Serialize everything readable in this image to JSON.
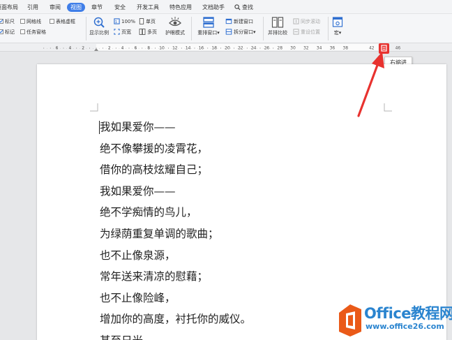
{
  "menu": {
    "tabs": [
      "页面布局",
      "引用",
      "审阅",
      "视图",
      "章节",
      "安全",
      "开发工具",
      "特色应用",
      "文档助手"
    ],
    "active_tab": "视图",
    "search_label": "查找"
  },
  "ribbon": {
    "checkboxes": {
      "ruler": "标尺",
      "gridlines": "网格线",
      "table_gridlines": "表格虚框",
      "marks": "标记",
      "task_pane": "任务窗格"
    },
    "display_ratio": "显示比例",
    "zoom_100": "100%",
    "page_width": "页宽",
    "single_page": "单页",
    "multi_page": "多页",
    "eye_mode": "护眼模式",
    "rearrange_window": "重排窗口",
    "new_window": "新建窗口",
    "split_window": "拆分窗口",
    "side_by_side": "并排比较",
    "sync_scroll": "同步滚动",
    "reset_position": "重设位置",
    "macro": "宏"
  },
  "ruler": {
    "labels": [
      "6",
      "4",
      "2",
      "2",
      "4",
      "6",
      "8",
      "10",
      "12",
      "14",
      "16",
      "18",
      "20",
      "22",
      "24",
      "26",
      "28",
      "30",
      "32",
      "34",
      "36",
      "38",
      "42",
      "44",
      "46"
    ]
  },
  "tooltip": {
    "text": "右缩进"
  },
  "document": {
    "lines": [
      "我如果爱你——",
      "绝不像攀援的凌霄花，",
      "借你的高枝炫耀自己；",
      "我如果爱你——",
      "绝不学痴情的鸟儿，",
      "为绿荫重复单调的歌曲；",
      "也不止像泉源，",
      "常年送来清凉的慰藉；",
      "也不止像险峰，",
      "增加你的高度，衬托你的威仪。",
      "甚至日光"
    ]
  },
  "watermark": {
    "title": "Office教程网",
    "url": "www.office26.com"
  },
  "colors": {
    "accent": "#3f7ee8",
    "arrow": "#e8322f",
    "watermark_blue": "#2a84cf",
    "logo_orange": "#ea5a18"
  }
}
